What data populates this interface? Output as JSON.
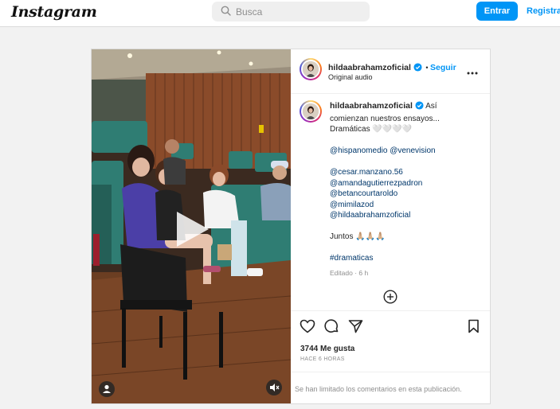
{
  "header": {
    "logo": "Instagram",
    "search_placeholder": "Busca",
    "login_label": "Entrar",
    "register_label": "Registrar"
  },
  "post": {
    "username": "hildaabrahamzoficial",
    "follow_label": "Seguir",
    "audio": "Original audio",
    "caption_lines": [
      "Así",
      "comienzan nuestros ensayos...",
      "Dramáticas 🤍🤍🤍🤍"
    ],
    "mentions_1": "@hispanomedio @venevision",
    "mentions_2": [
      "@cesar.manzano.56",
      "@amandagutierrezpadron",
      "@betancourtaroldo",
      "@mimilazod",
      "@hildaabrahamzoficial"
    ],
    "together": "Juntos 🙏🏼🙏🏼🙏🏼",
    "hashtag": "#dramaticas",
    "edited": "Editado · 6 h",
    "likes": "3744 Me gusta",
    "time_ago": "HACE 6 HORAS",
    "comments_limited": "Se han limitado los comentarios en esta publicación."
  },
  "icons": {
    "search": "search-icon",
    "verified": "verified-badge-icon",
    "more": "more-options-icon",
    "add_comment": "add-circle-icon",
    "like": "heart-icon",
    "comment": "comment-icon",
    "share": "share-icon",
    "save": "bookmark-icon",
    "tagged": "user-tag-icon",
    "audio": "speaker-icon",
    "play": "play-icon"
  },
  "colors": {
    "accent": "#0095f6",
    "text": "#262626",
    "muted": "#8e8e8e",
    "mention": "#00376b"
  }
}
